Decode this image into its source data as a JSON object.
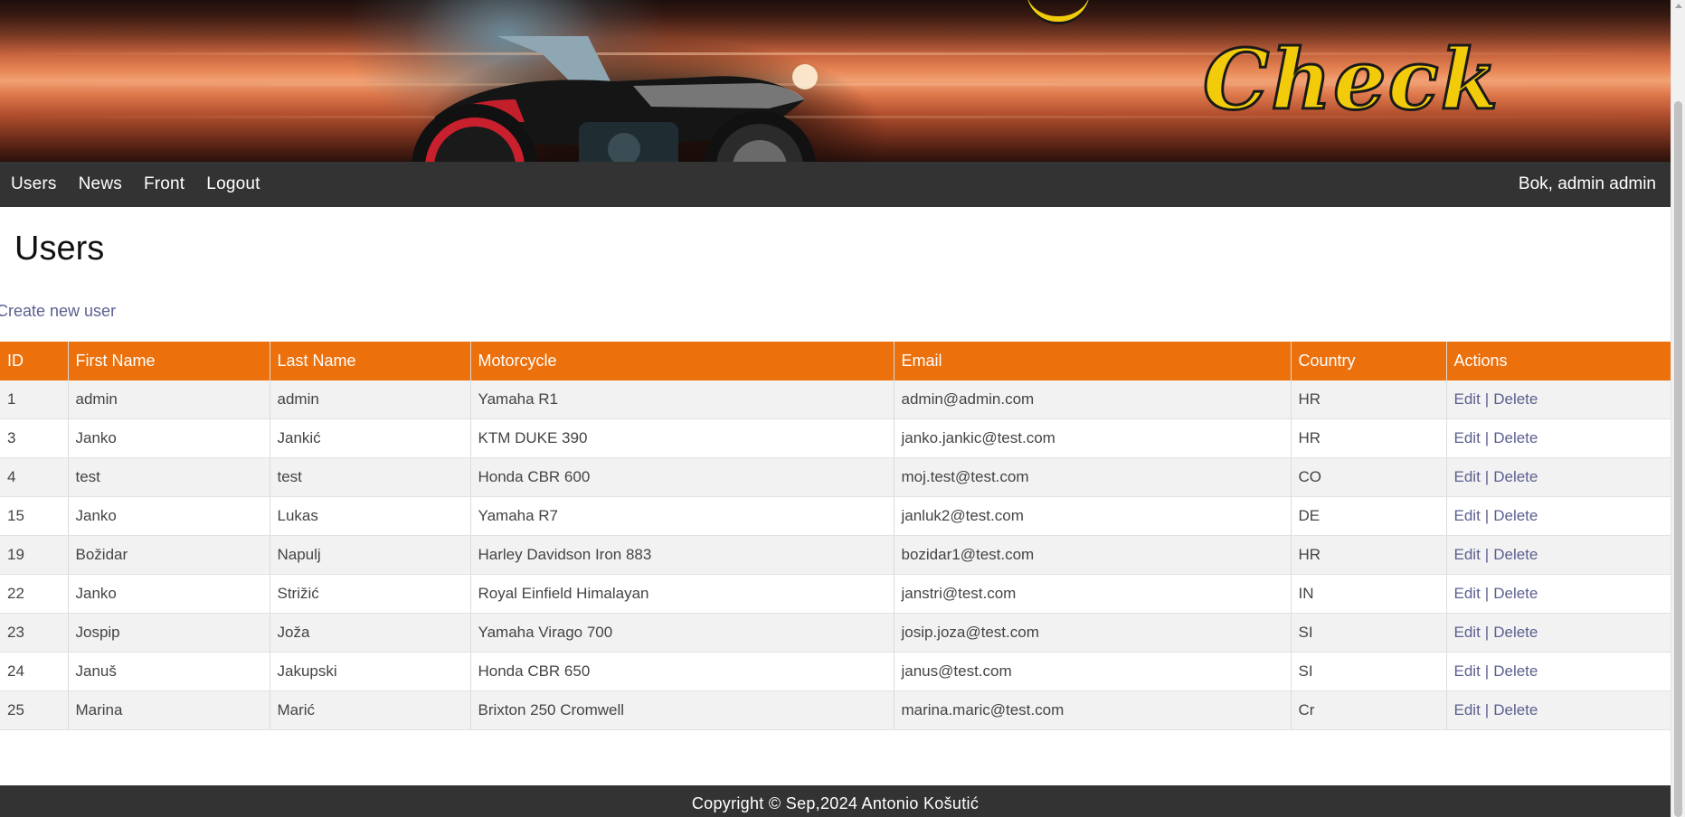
{
  "banner": {
    "logo_text": "Check"
  },
  "nav": {
    "links": [
      "Users",
      "News",
      "Front",
      "Logout"
    ],
    "greeting": "Bok, admin admin"
  },
  "page": {
    "title": "Users",
    "create_link": "Create new user"
  },
  "table": {
    "headers": [
      "ID",
      "First Name",
      "Last Name",
      "Motorcycle",
      "Email",
      "Country",
      "Actions"
    ],
    "rows": [
      {
        "id": "1",
        "first": "admin",
        "last": "admin",
        "moto": "Yamaha R1",
        "email": "admin@admin.com",
        "country": "HR"
      },
      {
        "id": "3",
        "first": "Janko",
        "last": "Jankić",
        "moto": "KTM DUKE 390",
        "email": "janko.jankic@test.com",
        "country": "HR"
      },
      {
        "id": "4",
        "first": "test",
        "last": "test",
        "moto": "Honda CBR 600",
        "email": "moj.test@test.com",
        "country": "CO"
      },
      {
        "id": "15",
        "first": "Janko",
        "last": "Lukas",
        "moto": "Yamaha R7",
        "email": "janluk2@test.com",
        "country": "DE"
      },
      {
        "id": "19",
        "first": "Božidar",
        "last": "Napulj",
        "moto": "Harley Davidson Iron 883",
        "email": "bozidar1@test.com",
        "country": "HR"
      },
      {
        "id": "22",
        "first": "Janko",
        "last": "Strižić",
        "moto": "Royal Einfield Himalayan",
        "email": "janstri@test.com",
        "country": "IN"
      },
      {
        "id": "23",
        "first": "Jospip",
        "last": "Joža",
        "moto": "Yamaha Virago 700",
        "email": "josip.joza@test.com",
        "country": "SI"
      },
      {
        "id": "24",
        "first": "Januš",
        "last": "Jakupski",
        "moto": "Honda CBR 650",
        "email": "janus@test.com",
        "country": "SI"
      },
      {
        "id": "25",
        "first": "Marina",
        "last": "Marić",
        "moto": "Brixton 250 Cromwell",
        "email": "marina.maric@test.com",
        "country": "Cr"
      }
    ],
    "actions": {
      "edit": "Edit",
      "separator": "|",
      "delete": "Delete"
    }
  },
  "footer": {
    "text": "Copyright © Sep,2024 Antonio Košutić"
  },
  "colors": {
    "nav_bg": "#333333",
    "header_row": "#ec700c",
    "link": "#5b5f8f"
  }
}
